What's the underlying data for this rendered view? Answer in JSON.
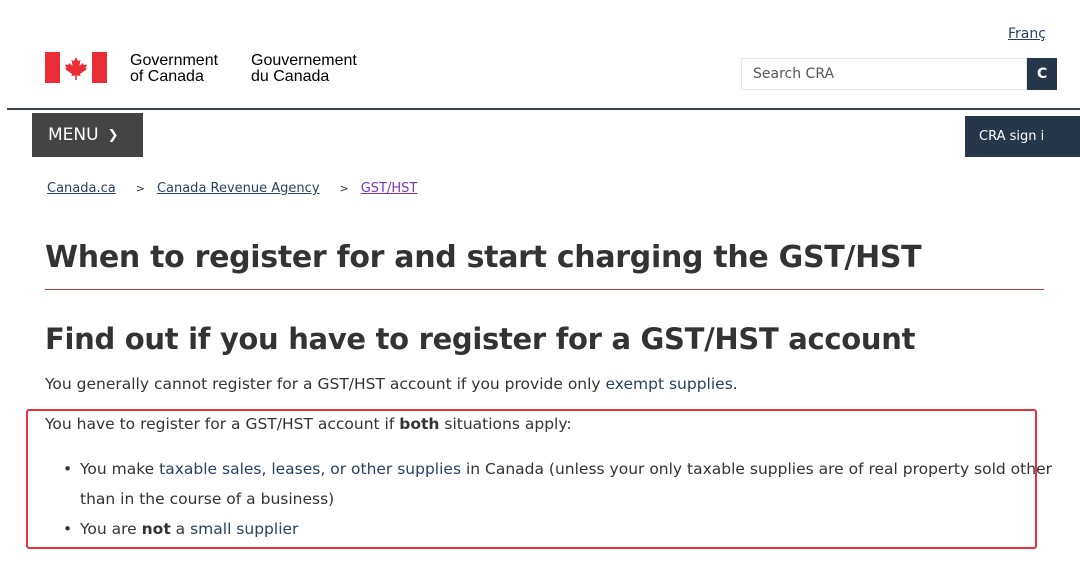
{
  "header": {
    "language_link": "Franç",
    "gov_name_en_line1": "Government",
    "gov_name_en_line2": "of Canada",
    "gov_name_fr_line1": "Gouvernement",
    "gov_name_fr_line2": "du Canada",
    "search_placeholder": "Search CRA",
    "search_button_label": "C",
    "flag_red": "#eb2d37"
  },
  "nav": {
    "menu_label": "MENU",
    "signin_label": "CRA sign i"
  },
  "breadcrumb": {
    "items": [
      "Canada.ca",
      "Canada Revenue Agency",
      "GST/HST"
    ],
    "separator": ">"
  },
  "main": {
    "title": "When to register for and start charging the GST/HST",
    "section_heading": "Find out if you have to register for a GST/HST account",
    "intro_before": "You generally cannot register for a GST/HST account if you provide only ",
    "intro_link": "exempt supplies",
    "intro_after": ".",
    "condition_before": "You have to register for a GST/HST account if ",
    "condition_bold": "both",
    "condition_after": " situations apply:",
    "bullet1_before": "You make ",
    "bullet1_link": "taxable sales, leases, or other supplies",
    "bullet1_after": " in Canada (unless your only taxable supplies are of real property sold other than in the course of a business)",
    "bullet2_before": "You are ",
    "bullet2_bold": "not",
    "bullet2_middle": " a ",
    "bullet2_link": "small supplier"
  },
  "colors": {
    "title_rule": "#af3c43",
    "highlight_border": "#e8323c",
    "dark_button": "#26374a",
    "menu_button": "#444444",
    "link": "#284162",
    "visited_link": "#7834bc"
  }
}
